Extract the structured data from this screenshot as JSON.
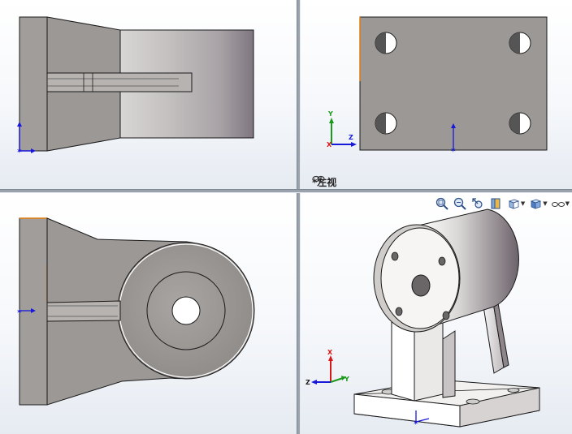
{
  "viewports": {
    "top_left": {
      "name": "top-left-view"
    },
    "top_right": {
      "name": "left-view",
      "label": "*左视"
    },
    "bottom_left": {
      "name": "bottom-left-view"
    },
    "bottom_right": {
      "name": "isometric-view"
    }
  },
  "triad": {
    "x": "X",
    "y": "Y",
    "z": "Z"
  },
  "heads_up_toolbar": [
    {
      "icon": "zoom-to-fit-icon"
    },
    {
      "icon": "zoom-to-area-icon"
    },
    {
      "icon": "previous-view-icon"
    },
    {
      "icon": "section-view-icon"
    },
    {
      "icon": "view-orientation-icon",
      "dropdown": true
    },
    {
      "icon": "display-style-icon",
      "dropdown": true
    },
    {
      "icon": "hide-show-items-icon",
      "dropdown": true
    }
  ],
  "colors": {
    "part_face": "#9c9896",
    "part_light": "#c9c6c4",
    "edge": "#1a1a1a",
    "selected_edge": "#e07b0a",
    "axis_x": "#d81818",
    "axis_y": "#1a9a1a",
    "axis_z": "#1818d8",
    "background_top": "#ffffff",
    "background_bottom": "#e6ebf2"
  }
}
